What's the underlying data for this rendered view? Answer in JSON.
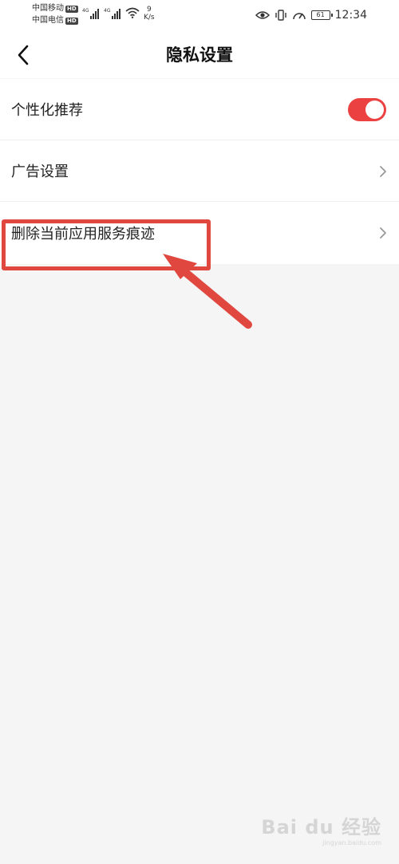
{
  "status_bar": {
    "carrier1": "中国移动",
    "carrier2": "中国电信",
    "hd": "HD",
    "network1": "4G",
    "network2": "4G",
    "speed_value": "9",
    "speed_unit": "K/s",
    "battery": "61",
    "time": "12:34",
    "icons": [
      "eye-icon",
      "vibrate-icon",
      "speedometer-icon",
      "wifi-icon",
      "signal-icon"
    ]
  },
  "header": {
    "back_icon": "chevron-left-icon",
    "title": "隐私设置"
  },
  "settings": {
    "items": [
      {
        "label": "个性化推荐",
        "control": "toggle",
        "enabled": true
      },
      {
        "label": "广告设置",
        "control": "chevron"
      },
      {
        "label": "删除当前应用服务痕迹",
        "control": "chevron"
      }
    ]
  },
  "annotation": {
    "highlight_color": "#e0483f",
    "target": "删除当前应用服务痕迹"
  },
  "watermark": {
    "logo": "Bai du 经验",
    "url": "jingyan.baidu.com"
  },
  "colors": {
    "toggle_on": "#ec4141",
    "background": "#f5f5f5",
    "annotation_red": "#e0483f"
  }
}
